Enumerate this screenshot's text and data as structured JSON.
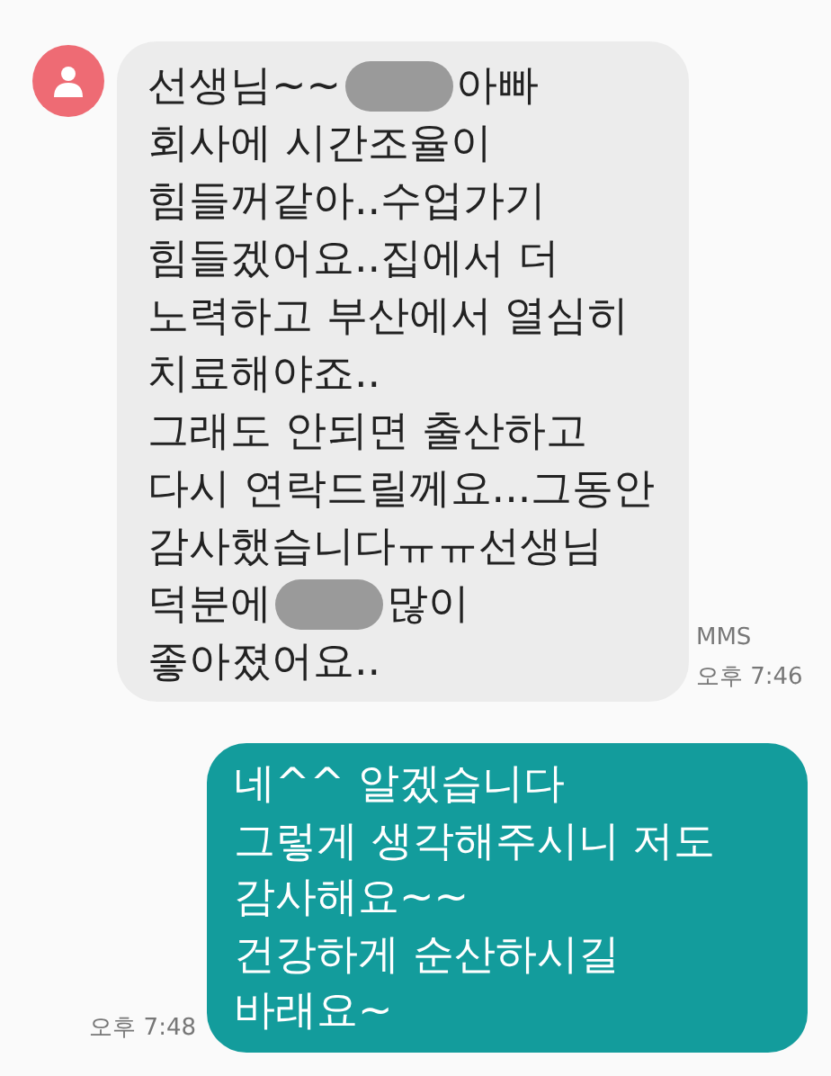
{
  "messages": [
    {
      "kind": "received",
      "lines": [
        [
          {
            "kind": "text",
            "text": "선생님~~"
          },
          {
            "kind": "redacted"
          },
          {
            "kind": "text",
            "text": "아빠"
          }
        ],
        [
          {
            "kind": "text",
            "text": "회사에 시간조율이"
          }
        ],
        [
          {
            "kind": "text",
            "text": "힘들꺼같아..수업가기"
          }
        ],
        [
          {
            "kind": "text",
            "text": "힘들겠어요..집에서 더"
          }
        ],
        [
          {
            "kind": "text",
            "text": "노력하고 부산에서 열심히"
          }
        ],
        [
          {
            "kind": "text",
            "text": "치료해야죠.."
          }
        ],
        [
          {
            "kind": "text",
            "text": "그래도 안되면 출산하고"
          }
        ],
        [
          {
            "kind": "text",
            "text": "다시 연락드릴께요...그동안"
          }
        ],
        [
          {
            "kind": "text",
            "text": "감사했습니다ㅠㅠ선생님"
          }
        ],
        [
          {
            "kind": "text",
            "text": "덕분에"
          },
          {
            "kind": "redacted"
          },
          {
            "kind": "text",
            "text": "많이"
          }
        ],
        [
          {
            "kind": "text",
            "text": "좋아졌어요.."
          }
        ]
      ],
      "meta": [
        "MMS",
        "오후 7:46"
      ]
    },
    {
      "kind": "sent",
      "lines": [
        [
          {
            "kind": "text",
            "text": "네^^  알겠습니다"
          }
        ],
        [
          {
            "kind": "text",
            "text": "그렇게 생각해주시니 저도"
          }
        ],
        [
          {
            "kind": "text",
            "text": "감사해요~~"
          }
        ],
        [
          {
            "kind": "text",
            "text": "건강하게 순산하시길"
          }
        ],
        [
          {
            "kind": "text",
            "text": "바래요~"
          }
        ]
      ],
      "meta": [
        "오후 7:48"
      ]
    }
  ]
}
